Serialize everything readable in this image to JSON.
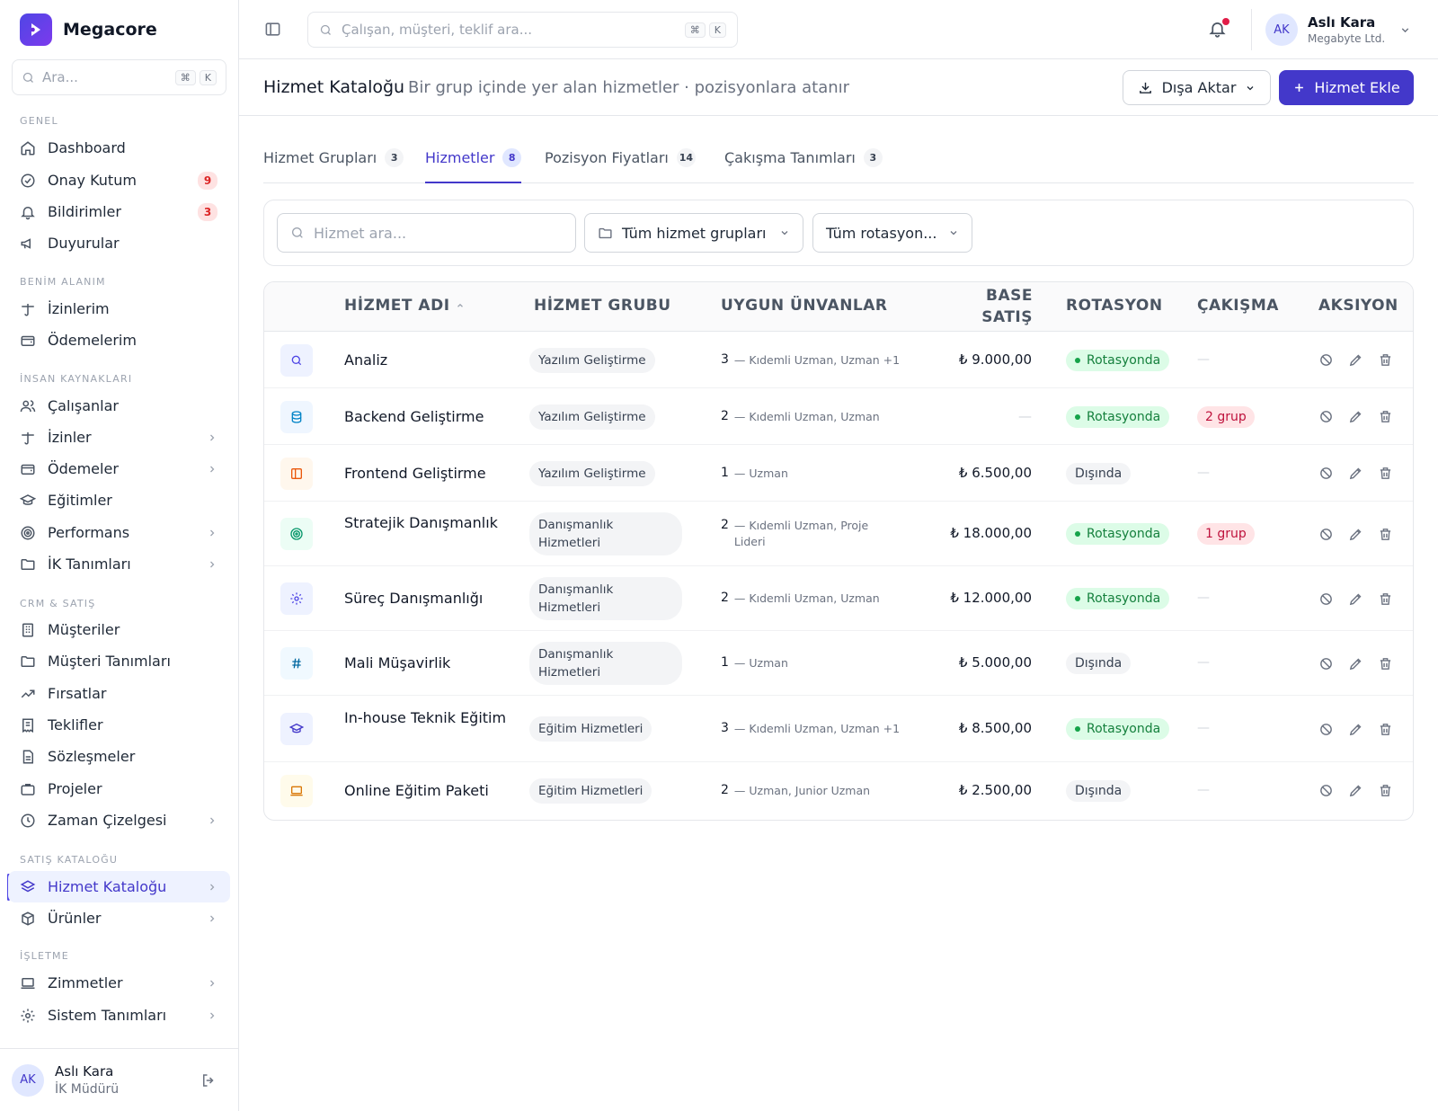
{
  "brand": {
    "name": "Megacore"
  },
  "sidebar": {
    "search_placeholder": "Ara...",
    "kbd1": "⌘",
    "kbd2": "K",
    "sections": [
      "GENEL",
      "BENİM ALANIM",
      "İNSAN KAYNAKLARI",
      "CRM & SATIŞ",
      "SATIŞ KATALOĞU",
      "İŞLETME"
    ],
    "items": [
      {
        "label": "Dashboard",
        "icon": "home-icon"
      },
      {
        "label": "Onay Kutum",
        "icon": "check-circle-icon",
        "badge": "9"
      },
      {
        "label": "Bildirimler",
        "icon": "bell-icon",
        "badge": "3"
      },
      {
        "label": "Duyurular",
        "icon": "megaphone-icon"
      },
      {
        "label": "İzinlerim",
        "icon": "umbrella-icon"
      },
      {
        "label": "Ödemelerim",
        "icon": "wallet-icon"
      },
      {
        "label": "Çalışanlar",
        "icon": "users-icon"
      },
      {
        "label": "İzinler",
        "icon": "umbrella-icon"
      },
      {
        "label": "Ödemeler",
        "icon": "wallet-icon"
      },
      {
        "label": "Eğitimler",
        "icon": "graduation-cap-icon"
      },
      {
        "label": "Performans",
        "icon": "target-icon"
      },
      {
        "label": "İK Tanımları",
        "icon": "folder-icon"
      },
      {
        "label": "Müşteriler",
        "icon": "building-icon"
      },
      {
        "label": "Müşteri Tanımları",
        "icon": "folder-icon"
      },
      {
        "label": "Fırsatlar",
        "icon": "trending-up-icon"
      },
      {
        "label": "Teklifler",
        "icon": "receipt-icon"
      },
      {
        "label": "Sözleşmeler",
        "icon": "file-text-icon"
      },
      {
        "label": "Projeler",
        "icon": "briefcase-icon"
      },
      {
        "label": "Zaman Çizelgesi",
        "icon": "clock-icon"
      },
      {
        "label": "Hizmet Kataloğu",
        "icon": "layers-icon"
      },
      {
        "label": "Ürünler",
        "icon": "box-icon"
      },
      {
        "label": "Zimmetler",
        "icon": "laptop-icon"
      },
      {
        "label": "Sistem Tanımları",
        "icon": "gear-icon"
      }
    ],
    "user": {
      "initials": "AK",
      "name": "Aslı Kara",
      "role": "İK Müdürü"
    }
  },
  "topbar": {
    "search_placeholder": "Çalışan, müşteri, teklif ara...",
    "kbd1": "⌘",
    "kbd2": "K",
    "user": {
      "initials": "AK",
      "name": "Aslı Kara",
      "company": "Megabyte Ltd."
    }
  },
  "page": {
    "title": "Hizmet Kataloğu",
    "subtitle": "Bir grup içinde yer alan hizmetler · pozisyonlara atanır",
    "export_label": "Dışa Aktar",
    "add_label": "Hizmet Ekle"
  },
  "tabs": [
    {
      "label": "Hizmet Grupları",
      "count": "3"
    },
    {
      "label": "Hizmetler",
      "count": "8"
    },
    {
      "label": "Pozisyon Fiyatları",
      "count": "14"
    },
    {
      "label": "Çakışma Tanımları",
      "count": "3"
    }
  ],
  "filters": {
    "search_placeholder": "Hizmet ara...",
    "group_select": "Tüm hizmet grupları",
    "rotation_select": "Tüm rotasyon..."
  },
  "table": {
    "headers": {
      "name": "HİZMET ADI",
      "group": "HİZMET GRUBU",
      "titles": "UYGUN ÜNVANLAR",
      "price_line1": "BASE",
      "price_line2": "SATIŞ",
      "rotation": "ROTASYON",
      "conflict": "ÇAKIŞMA",
      "action": "AKSIYON"
    },
    "rows": [
      {
        "name": "Analiz",
        "group": "Yazılım Geliştirme",
        "title_count": "3",
        "titles": "— Kıdemli Uzman, Uzman +1",
        "price": "₺ 9.000,00",
        "rotation": "Rotasyonda",
        "conflict": "—",
        "icon": "search-icon",
        "icon_bg": "#eef2ff",
        "icon_color": "#4f46e5"
      },
      {
        "name": "Backend Geliştirme",
        "group": "Yazılım Geliştirme",
        "title_count": "2",
        "titles": "— Kıdemli Uzman, Uzman",
        "price": "—",
        "rotation": "Rotasyonda",
        "conflict": "2 grup",
        "icon": "database-icon",
        "icon_bg": "#eff6ff",
        "icon_color": "#0284c7"
      },
      {
        "name": "Frontend Geliştirme",
        "group": "Yazılım Geliştirme",
        "title_count": "1",
        "titles": "— Uzman",
        "price": "₺ 6.500,00",
        "rotation": "Dışında",
        "conflict": "—",
        "icon": "layout-icon",
        "icon_bg": "#fff7ed",
        "icon_color": "#ea580c"
      },
      {
        "name": "Stratejik Danışmanlık",
        "group": "Danışmanlık Hizmetleri",
        "title_count": "2",
        "titles": "— Kıdemli Uzman, Proje Lideri",
        "price": "₺ 18.000,00",
        "rotation": "Rotasyonda",
        "conflict": "1 grup",
        "icon": "target-icon",
        "icon_bg": "#ecfdf5",
        "icon_color": "#059669"
      },
      {
        "name": "Süreç Danışmanlığı",
        "group": "Danışmanlık Hizmetleri",
        "title_count": "2",
        "titles": "— Kıdemli Uzman, Uzman",
        "price": "₺ 12.000,00",
        "rotation": "Rotasyonda",
        "conflict": "—",
        "icon": "gear-icon",
        "icon_bg": "#eef2ff",
        "icon_color": "#4f46e5"
      },
      {
        "name": "Mali Müşavirlik",
        "group": "Danışmanlık Hizmetleri",
        "title_count": "1",
        "titles": "— Uzman",
        "price": "₺ 5.000,00",
        "rotation": "Dışında",
        "conflict": "—",
        "icon": "hash-icon",
        "icon_bg": "#f0f9ff",
        "icon_color": "#0369a1"
      },
      {
        "name": "In-house Teknik Eğitim",
        "group": "Eğitim Hizmetleri",
        "title_count": "3",
        "titles": "— Kıdemli Uzman, Uzman +1",
        "price": "₺ 8.500,00",
        "rotation": "Rotasyonda",
        "conflict": "—",
        "icon": "graduation-cap-icon",
        "icon_bg": "#eef2ff",
        "icon_color": "#4338ca"
      },
      {
        "name": "Online Eğitim Paketi",
        "group": "Eğitim Hizmetleri",
        "title_count": "2",
        "titles": "— Uzman, Junior Uzman",
        "price": "₺ 2.500,00",
        "rotation": "Dışında",
        "conflict": "—",
        "icon": "laptop-icon",
        "icon_bg": "#fffbeb",
        "icon_color": "#d97706"
      }
    ]
  },
  "colors": {
    "accent": "#4338ca",
    "danger": "#e11d48",
    "success": "#16a34a"
  }
}
